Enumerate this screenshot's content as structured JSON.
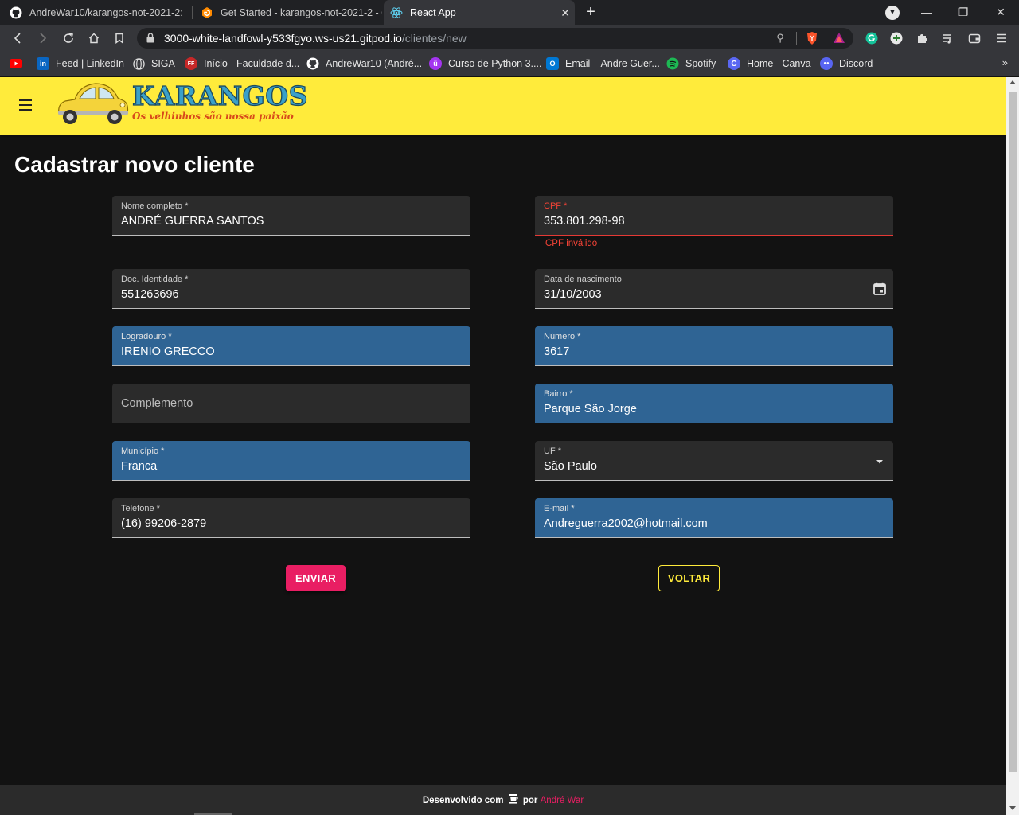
{
  "browser": {
    "tabs": [
      {
        "title": "AndreWar10/karangos-not-2021-2: ",
        "icon": "github-icon"
      },
      {
        "title": "Get Started - karangos-not-2021-2 - G",
        "icon": "gitpod-icon"
      },
      {
        "title": "React App",
        "icon": "react-icon",
        "active": true
      }
    ],
    "url_host": "3000-white-landfowl-y533fgyo.ws-us21.gitpod.io",
    "url_path": "/clientes/new",
    "bookmarks": [
      {
        "label": "",
        "icon": "youtube-icon"
      },
      {
        "label": "Feed | LinkedIn",
        "icon": "linkedin-icon"
      },
      {
        "label": "SIGA",
        "icon": "globe-icon"
      },
      {
        "label": "Início - Faculdade d...",
        "icon": "ff-icon"
      },
      {
        "label": "AndreWar10 (André...",
        "icon": "github-icon"
      },
      {
        "label": "Curso de Python 3....",
        "icon": "udemy-icon"
      },
      {
        "label": "Email – Andre Guer...",
        "icon": "outlook-icon"
      },
      {
        "label": "Spotify",
        "icon": "spotify-icon"
      },
      {
        "label": "Home - Canva",
        "icon": "canva-icon"
      },
      {
        "label": "Discord",
        "icon": "discord-icon"
      }
    ]
  },
  "app": {
    "logo_title": "KARANGOS",
    "logo_tagline": "Os velhinhos são nossa paixão",
    "page_title": "Cadastrar novo cliente"
  },
  "form": {
    "nome": {
      "label": "Nome completo *",
      "value": "ANDRÉ GUERRA SANTOS"
    },
    "cpf": {
      "label": "CPF *",
      "value": "353.801.298-98",
      "error": "CPF inválido"
    },
    "rg": {
      "label": "Doc. Identidade *",
      "value": "551263696"
    },
    "nascimento": {
      "label": "Data de nascimento",
      "value": "31/10/2003"
    },
    "logradouro": {
      "label": "Logradouro *",
      "value": "IRENIO GRECCO"
    },
    "numero": {
      "label": "Número *",
      "value": "3617"
    },
    "complemento": {
      "placeholder": "Complemento"
    },
    "bairro": {
      "label": "Bairro *",
      "value": "Parque São Jorge"
    },
    "municipio": {
      "label": "Município *",
      "value": "Franca"
    },
    "uf": {
      "label": "UF *",
      "value": "São Paulo"
    },
    "telefone": {
      "label": "Telefone *",
      "value": "(16) 99206-2879"
    },
    "email": {
      "label": "E-mail *",
      "value": "Andreguerra2002@hotmail.com"
    },
    "submit_label": "ENVIAR",
    "back_label": "VOLTAR"
  },
  "footer": {
    "prefix": "Desenvolvido com",
    "middle": "por",
    "author": "André War"
  },
  "colors": {
    "appbar": "#ffeb3b",
    "background": "#121212",
    "field_bg": "#2b2b2b",
    "autofill_bg": "#2f6494",
    "error": "#f44336",
    "primary_button": "#e91e63",
    "secondary_outline": "#ffeb3b"
  }
}
